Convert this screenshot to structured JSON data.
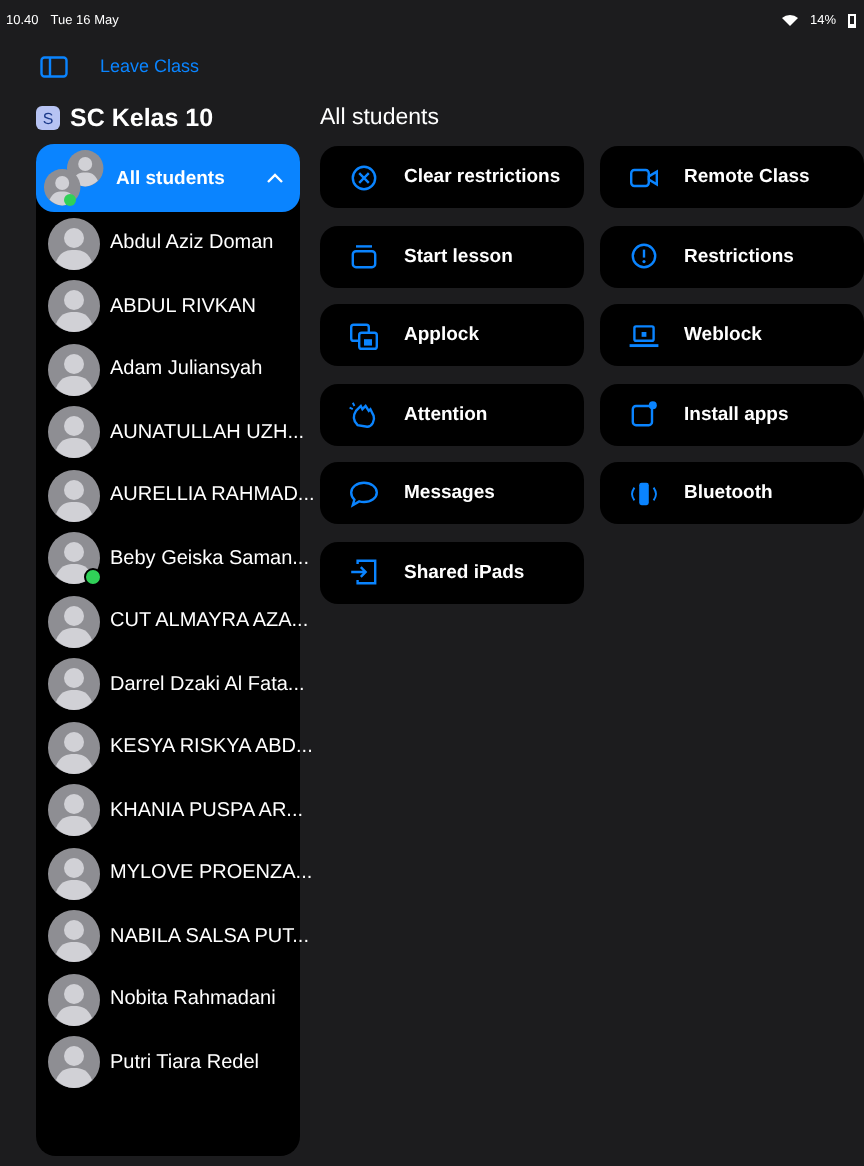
{
  "status_bar": {
    "time": "10.40",
    "date": "Tue 16 May",
    "battery": "14%"
  },
  "toolbar": {
    "leave_button": "Leave Class"
  },
  "class": {
    "badge": "S",
    "title": "SC Kelas 10"
  },
  "sidebar": {
    "group": {
      "label": "All students",
      "selected": true,
      "expanded": true,
      "online": true
    },
    "students": [
      {
        "name": "Abdul Aziz Doman",
        "selected": false,
        "online": false
      },
      {
        "name": "ABDUL RIVKAN",
        "selected": false,
        "online": false
      },
      {
        "name": "Adam Juliansyah",
        "selected": false,
        "online": false
      },
      {
        "name": "AUNATULLAH UZH...",
        "selected": false,
        "online": false
      },
      {
        "name": "AURELLIA RAHMAD...",
        "selected": false,
        "online": false
      },
      {
        "name": "Beby Geiska Saman...",
        "selected": false,
        "online": true
      },
      {
        "name": "CUT ALMAYRA AZA...",
        "selected": false,
        "online": false
      },
      {
        "name": "Darrel Dzaki Al Fata...",
        "selected": false,
        "online": false
      },
      {
        "name": "KESYA RISKYA ABD...",
        "selected": false,
        "online": false
      },
      {
        "name": "KHANIA PUSPA AR...",
        "selected": false,
        "online": false
      },
      {
        "name": "MYLOVE PROENZA...",
        "selected": false,
        "online": false
      },
      {
        "name": "NABILA SALSA PUT...",
        "selected": false,
        "online": false
      },
      {
        "name": "Nobita Rahmadani",
        "selected": false,
        "online": false
      },
      {
        "name": "Putri Tiara Redel",
        "selected": false,
        "online": false
      }
    ]
  },
  "main": {
    "heading": "All students",
    "actions": [
      {
        "label": "Clear restrictions",
        "kind": "clear"
      },
      {
        "label": "Remote Class",
        "kind": "video"
      },
      {
        "label": "Start lesson",
        "kind": "lesson"
      },
      {
        "label": "Restrictions",
        "kind": "info"
      },
      {
        "label": "Applock",
        "kind": "applock"
      },
      {
        "label": "Weblock",
        "kind": "weblock"
      },
      {
        "label": "Attention",
        "kind": "attention"
      },
      {
        "label": "Install apps",
        "kind": "install"
      },
      {
        "label": "Messages",
        "kind": "message"
      },
      {
        "label": "Bluetooth",
        "kind": "bluetooth"
      },
      {
        "label": "Shared iPads",
        "kind": "shared"
      }
    ]
  }
}
